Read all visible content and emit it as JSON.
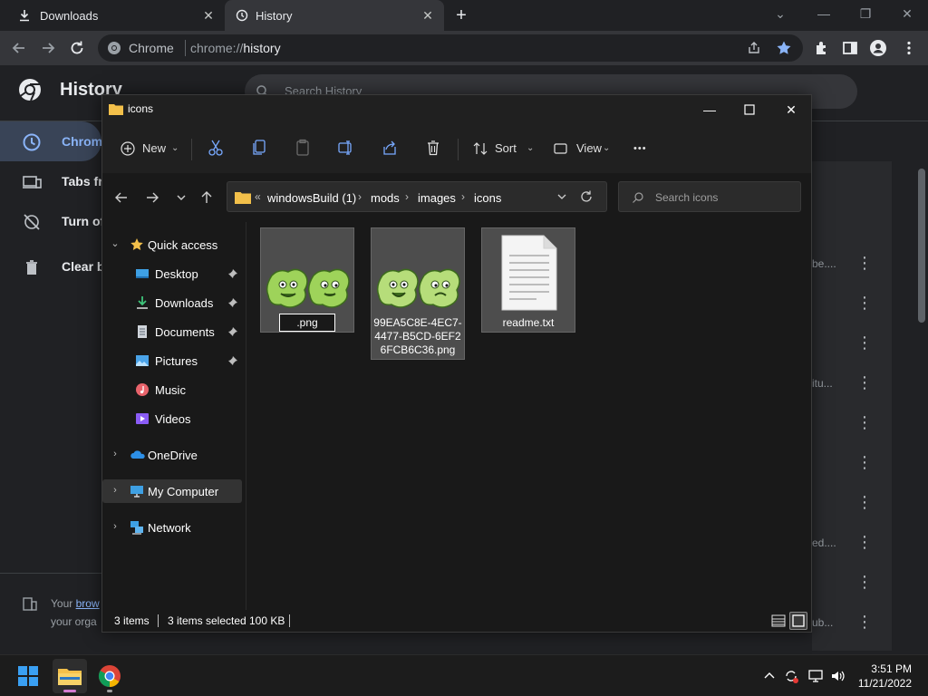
{
  "chrome": {
    "tabs": [
      {
        "label": "Downloads",
        "close": "✕"
      },
      {
        "label": "History",
        "close": "✕"
      }
    ],
    "new_tab": "+",
    "window_controls": {
      "minimize": "—",
      "restore": "❐",
      "close": "✕"
    },
    "omnibox": {
      "site": "Chrome",
      "url_prefix": "chrome://",
      "url_host": "history"
    }
  },
  "history_page": {
    "title": "History",
    "search_placeholder": "Search History",
    "sidebar": [
      {
        "label": "Chrome"
      },
      {
        "label": "Tabs fr"
      },
      {
        "label": "Turn of"
      },
      {
        "label": "Clear b"
      }
    ],
    "snippets": [
      "be....",
      "itu...",
      "ed....",
      "ub..."
    ],
    "org_note": {
      "line1_prefix": "Your ",
      "line1_link": "brow",
      "line2": "your orga"
    }
  },
  "explorer": {
    "title": "icons",
    "commands": {
      "new": "New",
      "sort": "Sort",
      "view": "View",
      "more": "•••"
    },
    "breadcrumb": [
      "windowsBuild (1)",
      "mods",
      "images",
      "icons"
    ],
    "breadcrumb_overflow": "«",
    "search_placeholder": "Search icons",
    "nav": {
      "quick_access": "Quick access",
      "items": [
        {
          "label": "Desktop",
          "pinned": true
        },
        {
          "label": "Downloads",
          "pinned": true
        },
        {
          "label": "Documents",
          "pinned": true
        },
        {
          "label": "Pictures",
          "pinned": true
        },
        {
          "label": "Music",
          "pinned": false
        },
        {
          "label": "Videos",
          "pinned": false
        }
      ],
      "onedrive": "OneDrive",
      "my_computer": "My Computer",
      "network": "Network"
    },
    "files": [
      {
        "name": ".png",
        "renaming": true
      },
      {
        "name_lines": [
          "99EA5C8E-4EC7-",
          "4477-B5CD-6EF2",
          "6FCB6C36.png"
        ]
      },
      {
        "name": "readme.txt"
      }
    ],
    "status": {
      "items": "3 items",
      "selected": "3 items selected",
      "size": "100 KB"
    }
  },
  "taskbar": {
    "time": "3:51 PM",
    "date": "11/21/2022"
  },
  "colors": {
    "accent": "#8ab4f8",
    "folder": "#f3c04a",
    "sprite_green": "#9ed35a"
  }
}
